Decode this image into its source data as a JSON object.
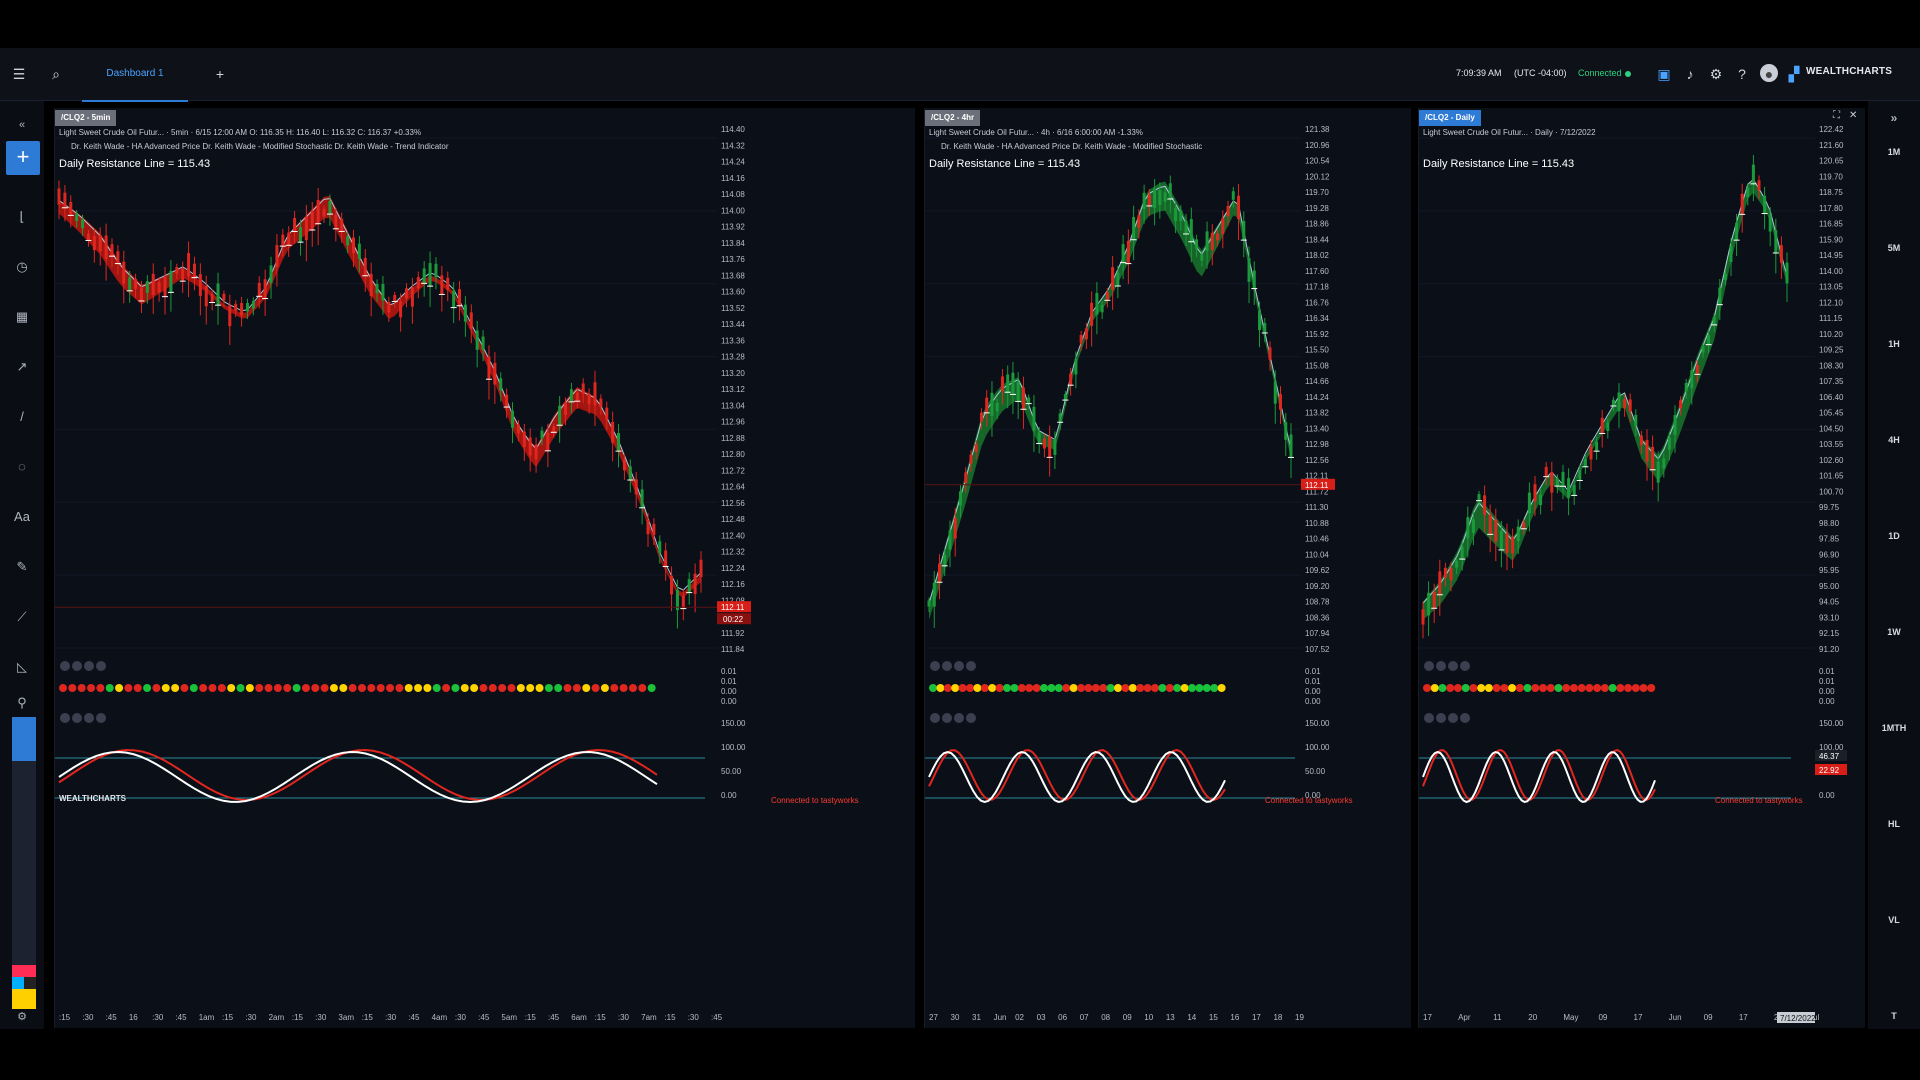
{
  "header": {
    "tab": "Dashboard 1",
    "time": "7:09:39 AM",
    "timezone": "(UTC -04:00)",
    "status": "Connected",
    "brand": "WEALTHCHARTS"
  },
  "timeframes": [
    "1M",
    "5M",
    "1H",
    "4H",
    "1D",
    "1W",
    "1MTH",
    "HL",
    "VL",
    "T"
  ],
  "resistance_label": "Daily Resistance Line = 115.43",
  "connected_label": "Connected to tastyworks",
  "watermark": "WEALTHCHARTS",
  "panels": [
    {
      "title": "/CLQ2 - 5min",
      "info": "Light Sweet Crude Oil Futur... · 5min · 6/15 12:00 AM O: 116.35 H: 116.40 L: 116.32 C: 116.37 +0.33%",
      "indicators": "Dr. Keith Wade - HA Advanced Price    Dr. Keith Wade - Modified Stochastic    Dr. Keith Wade - Trend Indicator",
      "price_ticks": [
        "114.40",
        "114.32",
        "114.24",
        "114.16",
        "114.08",
        "114.00",
        "113.92",
        "113.84",
        "113.76",
        "113.68",
        "113.60",
        "113.52",
        "113.44",
        "113.36",
        "113.28",
        "113.20",
        "113.12",
        "113.04",
        "112.96",
        "112.88",
        "112.80",
        "112.72",
        "112.64",
        "112.56",
        "112.48",
        "112.40",
        "112.32",
        "112.24",
        "112.16",
        "112.08",
        "112.00",
        "111.92",
        "111.84"
      ],
      "last_price": "112.11",
      "countdown": "00:22",
      "time_ticks": [
        ":15",
        ":30",
        ":45",
        "16",
        ":30",
        ":45",
        "1am",
        ":15",
        ":30",
        "2am",
        ":15",
        ":30",
        "3am",
        ":15",
        ":30",
        ":45",
        "4am",
        ":30",
        ":45",
        "5am",
        ":15",
        ":45",
        "6am",
        ":15",
        ":30",
        "7am",
        ":15",
        ":30",
        ":45"
      ]
    },
    {
      "title": "/CLQ2 - 4hr",
      "info": "Light Sweet Crude Oil Futur... · 4h · 6/16 6:00:00 AM  -1.33%",
      "indicators": "Dr. Keith Wade - HA Advanced Price    Dr. Keith Wade - Modified Stochastic",
      "price_ticks": [
        "121.38",
        "120.96",
        "120.54",
        "120.12",
        "119.70",
        "119.28",
        "118.86",
        "118.44",
        "118.02",
        "117.60",
        "117.18",
        "116.76",
        "116.34",
        "115.92",
        "115.50",
        "115.08",
        "114.66",
        "114.24",
        "113.82",
        "113.40",
        "112.98",
        "112.56",
        "112.11",
        "111.72",
        "111.30",
        "110.88",
        "110.46",
        "110.04",
        "109.62",
        "109.20",
        "108.78",
        "108.36",
        "107.94",
        "107.52"
      ],
      "last_price": "112.11",
      "time_ticks": [
        "27",
        "30",
        "31",
        "Jun",
        "02",
        "03",
        "06",
        "07",
        "08",
        "09",
        "10",
        "13",
        "14",
        "15",
        "16",
        "17",
        "18",
        "19"
      ]
    },
    {
      "title": "/CLQ2 - Daily",
      "info": "Light Sweet Crude Oil Futur... · Daily · 7/12/2022",
      "price_ticks": [
        "122.42",
        "121.60",
        "120.65",
        "119.70",
        "118.75",
        "117.80",
        "116.85",
        "115.90",
        "114.95",
        "114.00",
        "113.05",
        "112.10",
        "111.15",
        "110.20",
        "109.25",
        "108.30",
        "107.35",
        "106.40",
        "105.45",
        "104.50",
        "103.55",
        "102.60",
        "101.65",
        "100.70",
        "99.75",
        "98.80",
        "97.85",
        "96.90",
        "95.95",
        "95.00",
        "94.05",
        "93.10",
        "92.15",
        "91.20"
      ],
      "time_ticks": [
        "17",
        "Apr",
        "11",
        "20",
        "May",
        "09",
        "17",
        "Jun",
        "09",
        "17",
        "23",
        "Jul"
      ],
      "date_tag": "7/12/2022"
    }
  ],
  "osc_ticks": [
    "0.01",
    "0.01",
    "0.00",
    "0.00"
  ],
  "stoch_ticks": [
    "150.00",
    "100.00",
    "50.00",
    "0.00"
  ],
  "daily_stoch_values": [
    "46.37",
    "22.92"
  ],
  "colors": {
    "up": "#1a9a3a",
    "down": "#e0271f",
    "accent": "#2e7bd6",
    "bg": "#0b0f18"
  }
}
